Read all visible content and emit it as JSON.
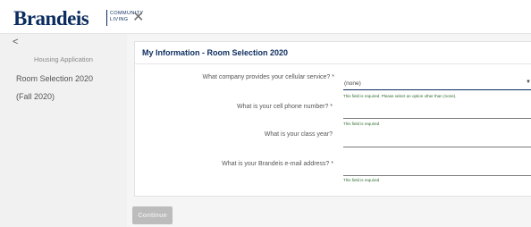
{
  "brand": {
    "name": "Brandeis",
    "sub_line1": "COMMUNITY",
    "sub_line2": "LIVING"
  },
  "header": {
    "close_glyph": "✕"
  },
  "sidebar": {
    "back_glyph": "<",
    "title": "Housing Application",
    "items": [
      {
        "label": "Room Selection 2020"
      },
      {
        "label": "(Fall 2020)"
      }
    ]
  },
  "form": {
    "title": "My Information - Room Selection 2020",
    "questions": [
      {
        "label": "What company provides your cellular service? *",
        "value": "(none)",
        "error": "This field is required. Please select an option other than (none)."
      },
      {
        "label": "What is your cell phone number? *",
        "value": "",
        "error": "This field is required"
      },
      {
        "label": "What is your class year?",
        "value": "",
        "error": ""
      },
      {
        "label": "What is your Brandeis e-mail address? *",
        "value": "",
        "error": "This field is required"
      }
    ],
    "continue_label": "Continue"
  },
  "icons": {
    "close": "close-icon",
    "back": "chevron-left-icon",
    "dropdown": "caret-down-icon"
  },
  "colors": {
    "brand_navy": "#0b2c5f",
    "error_green": "#2e6b2e",
    "disabled_button": "#bcbcbc"
  }
}
